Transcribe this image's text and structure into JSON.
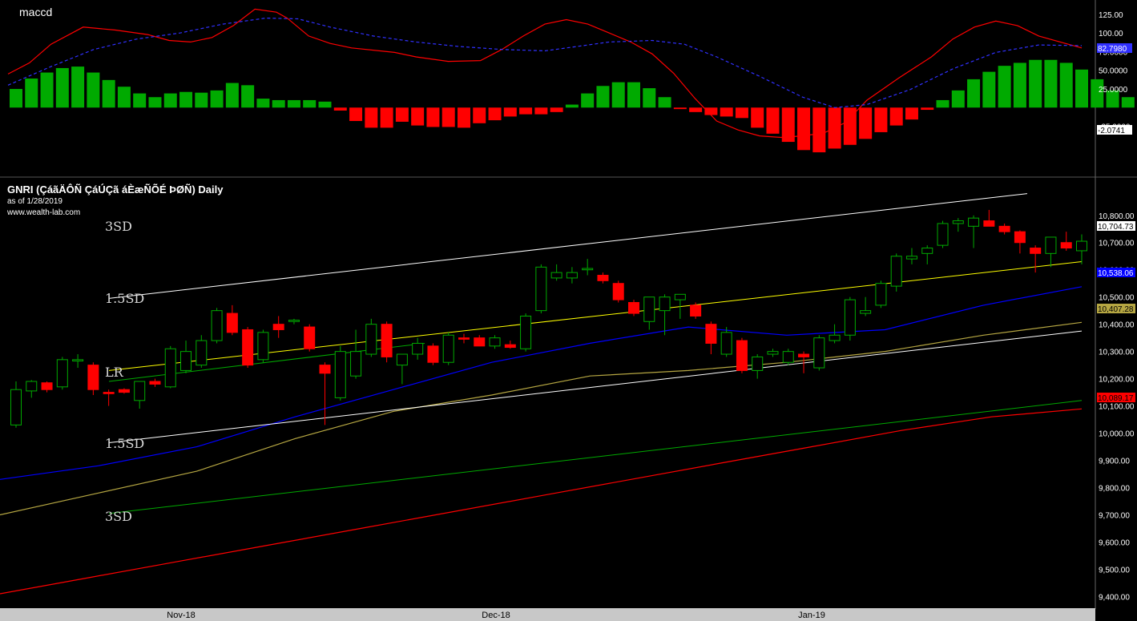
{
  "title": "GNRI (ÇáãÄÔÑ ÇáÚÇã áÈæÑÕÉ ÞØÑ) Daily",
  "as_of": "as of 1/28/2019",
  "site": "www.wealth-lab.com",
  "macd_label": "maccd",
  "sd_labels": {
    "up3": "3SD",
    "up15": "1.5SD",
    "lr": "LR",
    "dn15": "1.5SD",
    "dn3": "3SD"
  },
  "colors": {
    "background": "#000000",
    "up": "#00aa00",
    "down": "#ff0000",
    "macd_line": "#ff0000",
    "signal": "#3030ff",
    "lr_line": "#ffff00",
    "sd_line": "#ffffff",
    "ma_blue": "#0000ff",
    "ma_olive": "#b5a642",
    "ma_green": "#00aa00",
    "ma_red": "#ff0000"
  },
  "chart_data": {
    "type": "candlestick",
    "x_ticks": [
      "Nov-18",
      "Dec-18",
      "Jan-19"
    ],
    "price_axis": {
      "ticks": [
        "10,800.00",
        "10,700.00",
        "10,600.00",
        "10,500.00",
        "10,400.00",
        "10,300.00",
        "10,200.00",
        "10,100.00",
        "10,000.00",
        "9,900.00",
        "9,800.00",
        "9,700.00",
        "9,600.00",
        "9,500.00",
        "9,400.00"
      ],
      "ylim": [
        9360,
        10920
      ]
    },
    "macd_axis": {
      "ticks": [
        "125.00",
        "100.00",
        "75.0000",
        "50.0000",
        "25.0000",
        "-25.0000"
      ],
      "ylim": [
        -90,
        140
      ]
    },
    "last_values": {
      "close": "10,704.73",
      "ma_blue": "10,538.06",
      "ma_olive": "10,407.28",
      "ma_red": "10,089.17",
      "signal": "82.7980",
      "histogram": "-2.0741"
    },
    "candles": [
      {
        "o": 10030,
        "h": 10190,
        "l": 10020,
        "c": 10160
      },
      {
        "o": 10155,
        "h": 10195,
        "l": 10130,
        "c": 10190
      },
      {
        "o": 10185,
        "h": 10190,
        "l": 10150,
        "c": 10160
      },
      {
        "o": 10170,
        "h": 10280,
        "l": 10160,
        "c": 10270
      },
      {
        "o": 10265,
        "h": 10290,
        "l": 10240,
        "c": 10270
      },
      {
        "o": 10250,
        "h": 10260,
        "l": 10140,
        "c": 10160
      },
      {
        "o": 10150,
        "h": 10160,
        "l": 10100,
        "c": 10145
      },
      {
        "o": 10160,
        "h": 10165,
        "l": 10145,
        "c": 10150
      },
      {
        "o": 10120,
        "h": 10190,
        "l": 10090,
        "c": 10190
      },
      {
        "o": 10190,
        "h": 10200,
        "l": 10170,
        "c": 10180
      },
      {
        "o": 10170,
        "h": 10320,
        "l": 10165,
        "c": 10310
      },
      {
        "o": 10230,
        "h": 10340,
        "l": 10220,
        "c": 10300
      },
      {
        "o": 10250,
        "h": 10360,
        "l": 10240,
        "c": 10340
      },
      {
        "o": 10340,
        "h": 10460,
        "l": 10330,
        "c": 10450
      },
      {
        "o": 10440,
        "h": 10470,
        "l": 10360,
        "c": 10370
      },
      {
        "o": 10380,
        "h": 10390,
        "l": 10240,
        "c": 10250
      },
      {
        "o": 10270,
        "h": 10380,
        "l": 10260,
        "c": 10370
      },
      {
        "o": 10400,
        "h": 10430,
        "l": 10350,
        "c": 10380
      },
      {
        "o": 10410,
        "h": 10420,
        "l": 10400,
        "c": 10415
      },
      {
        "o": 10390,
        "h": 10400,
        "l": 10300,
        "c": 10310
      },
      {
        "o": 10250,
        "h": 10260,
        "l": 10030,
        "c": 10220
      },
      {
        "o": 10130,
        "h": 10320,
        "l": 10120,
        "c": 10300
      },
      {
        "o": 10210,
        "h": 10380,
        "l": 10200,
        "c": 10300
      },
      {
        "o": 10290,
        "h": 10420,
        "l": 10280,
        "c": 10400
      },
      {
        "o": 10400,
        "h": 10410,
        "l": 10260,
        "c": 10280
      },
      {
        "o": 10250,
        "h": 10290,
        "l": 10180,
        "c": 10290
      },
      {
        "o": 10290,
        "h": 10350,
        "l": 10270,
        "c": 10330
      },
      {
        "o": 10320,
        "h": 10330,
        "l": 10250,
        "c": 10260
      },
      {
        "o": 10260,
        "h": 10370,
        "l": 10250,
        "c": 10360
      },
      {
        "o": 10350,
        "h": 10365,
        "l": 10330,
        "c": 10345
      },
      {
        "o": 10350,
        "h": 10360,
        "l": 10320,
        "c": 10320
      },
      {
        "o": 10320,
        "h": 10360,
        "l": 10310,
        "c": 10350
      },
      {
        "o": 10325,
        "h": 10340,
        "l": 10310,
        "c": 10315
      },
      {
        "o": 10310,
        "h": 10440,
        "l": 10300,
        "c": 10430
      },
      {
        "o": 10450,
        "h": 10620,
        "l": 10440,
        "c": 10610
      },
      {
        "o": 10570,
        "h": 10620,
        "l": 10560,
        "c": 10590
      },
      {
        "o": 10570,
        "h": 10610,
        "l": 10550,
        "c": 10590
      },
      {
        "o": 10600,
        "h": 10640,
        "l": 10580,
        "c": 10605
      },
      {
        "o": 10580,
        "h": 10590,
        "l": 10550,
        "c": 10560
      },
      {
        "o": 10550,
        "h": 10560,
        "l": 10480,
        "c": 10490
      },
      {
        "o": 10480,
        "h": 10490,
        "l": 10430,
        "c": 10440
      },
      {
        "o": 10410,
        "h": 10500,
        "l": 10380,
        "c": 10500
      },
      {
        "o": 10450,
        "h": 10510,
        "l": 10360,
        "c": 10500
      },
      {
        "o": 10490,
        "h": 10510,
        "l": 10420,
        "c": 10510
      },
      {
        "o": 10470,
        "h": 10480,
        "l": 10420,
        "c": 10430
      },
      {
        "o": 10400,
        "h": 10410,
        "l": 10290,
        "c": 10330
      },
      {
        "o": 10290,
        "h": 10390,
        "l": 10280,
        "c": 10370
      },
      {
        "o": 10340,
        "h": 10350,
        "l": 10220,
        "c": 10230
      },
      {
        "o": 10230,
        "h": 10290,
        "l": 10200,
        "c": 10280
      },
      {
        "o": 10290,
        "h": 10310,
        "l": 10280,
        "c": 10300
      },
      {
        "o": 10260,
        "h": 10310,
        "l": 10250,
        "c": 10300
      },
      {
        "o": 10290,
        "h": 10300,
        "l": 10220,
        "c": 10280
      },
      {
        "o": 10240,
        "h": 10360,
        "l": 10230,
        "c": 10350
      },
      {
        "o": 10340,
        "h": 10400,
        "l": 10330,
        "c": 10360
      },
      {
        "o": 10360,
        "h": 10500,
        "l": 10340,
        "c": 10490
      },
      {
        "o": 10440,
        "h": 10500,
        "l": 10430,
        "c": 10450
      },
      {
        "o": 10470,
        "h": 10560,
        "l": 10460,
        "c": 10550
      },
      {
        "o": 10540,
        "h": 10660,
        "l": 10520,
        "c": 10650
      },
      {
        "o": 10640,
        "h": 10680,
        "l": 10620,
        "c": 10650
      },
      {
        "o": 10660,
        "h": 10690,
        "l": 10620,
        "c": 10680
      },
      {
        "o": 10690,
        "h": 10780,
        "l": 10680,
        "c": 10770
      },
      {
        "o": 10770,
        "h": 10790,
        "l": 10740,
        "c": 10780
      },
      {
        "o": 10760,
        "h": 10800,
        "l": 10680,
        "c": 10790
      },
      {
        "o": 10780,
        "h": 10820,
        "l": 10760,
        "c": 10760
      },
      {
        "o": 10760,
        "h": 10770,
        "l": 10730,
        "c": 10740
      },
      {
        "o": 10740,
        "h": 10745,
        "l": 10660,
        "c": 10700
      },
      {
        "o": 10680,
        "h": 10690,
        "l": 10590,
        "c": 10660
      },
      {
        "o": 10660,
        "h": 10720,
        "l": 10610,
        "c": 10720
      },
      {
        "o": 10700,
        "h": 10740,
        "l": 10670,
        "c": 10680
      },
      {
        "o": 10670,
        "h": 10730,
        "l": 10620,
        "c": 10705
      }
    ],
    "histogram": [
      25,
      39,
      47,
      53,
      55,
      47,
      37,
      28,
      19,
      14,
      19,
      21,
      20,
      23,
      33,
      30,
      12,
      10,
      10,
      10,
      8,
      -4,
      -18,
      -27,
      -27,
      -19,
      -24,
      -26,
      -26,
      -27,
      -21,
      -17,
      -12,
      -9,
      -9,
      -6,
      4,
      19,
      29,
      34,
      34,
      26,
      14,
      -2,
      -6,
      -10,
      -12,
      -14,
      -27,
      -35,
      -46,
      -57,
      -60,
      -55,
      -50,
      -42,
      -33,
      -24,
      -16,
      -3,
      10,
      23,
      38,
      48,
      56,
      60,
      64,
      64,
      60,
      51,
      38,
      23,
      14,
      -2
    ],
    "macd_line": [
      [
        0,
        45
      ],
      [
        0.02,
        60
      ],
      [
        0.04,
        85
      ],
      [
        0.07,
        108
      ],
      [
        0.1,
        104
      ],
      [
        0.13,
        98
      ],
      [
        0.15,
        90
      ],
      [
        0.17,
        88
      ],
      [
        0.19,
        94
      ],
      [
        0.21,
        110
      ],
      [
        0.23,
        132
      ],
      [
        0.25,
        128
      ],
      [
        0.26,
        120
      ],
      [
        0.28,
        96
      ],
      [
        0.3,
        86
      ],
      [
        0.32,
        80
      ],
      [
        0.36,
        74
      ],
      [
        0.38,
        68
      ],
      [
        0.41,
        62
      ],
      [
        0.44,
        63
      ],
      [
        0.46,
        78
      ],
      [
        0.48,
        96
      ],
      [
        0.5,
        112
      ],
      [
        0.52,
        118
      ],
      [
        0.54,
        112
      ],
      [
        0.56,
        100
      ],
      [
        0.58,
        88
      ],
      [
        0.6,
        72
      ],
      [
        0.62,
        46
      ],
      [
        0.64,
        12
      ],
      [
        0.66,
        -18
      ],
      [
        0.68,
        -30
      ],
      [
        0.7,
        -38
      ],
      [
        0.72,
        -40
      ],
      [
        0.74,
        -38
      ],
      [
        0.76,
        -34
      ],
      [
        0.78,
        -20
      ],
      [
        0.8,
        10
      ],
      [
        0.83,
        40
      ],
      [
        0.86,
        68
      ],
      [
        0.88,
        92
      ],
      [
        0.9,
        108
      ],
      [
        0.92,
        116
      ],
      [
        0.94,
        110
      ],
      [
        0.96,
        96
      ],
      [
        0.98,
        88
      ],
      [
        1,
        80
      ]
    ],
    "signal_line": [
      [
        0,
        30
      ],
      [
        0.04,
        55
      ],
      [
        0.08,
        78
      ],
      [
        0.12,
        92
      ],
      [
        0.16,
        100
      ],
      [
        0.2,
        112
      ],
      [
        0.24,
        120
      ],
      [
        0.27,
        119
      ],
      [
        0.3,
        108
      ],
      [
        0.34,
        96
      ],
      [
        0.38,
        88
      ],
      [
        0.42,
        82
      ],
      [
        0.46,
        78
      ],
      [
        0.5,
        76
      ],
      [
        0.53,
        82
      ],
      [
        0.56,
        88
      ],
      [
        0.6,
        90
      ],
      [
        0.63,
        85
      ],
      [
        0.66,
        68
      ],
      [
        0.7,
        42
      ],
      [
        0.74,
        14
      ],
      [
        0.77,
        0
      ],
      [
        0.8,
        4
      ],
      [
        0.84,
        24
      ],
      [
        0.88,
        52
      ],
      [
        0.92,
        74
      ],
      [
        0.96,
        84
      ],
      [
        1,
        83
      ]
    ]
  }
}
